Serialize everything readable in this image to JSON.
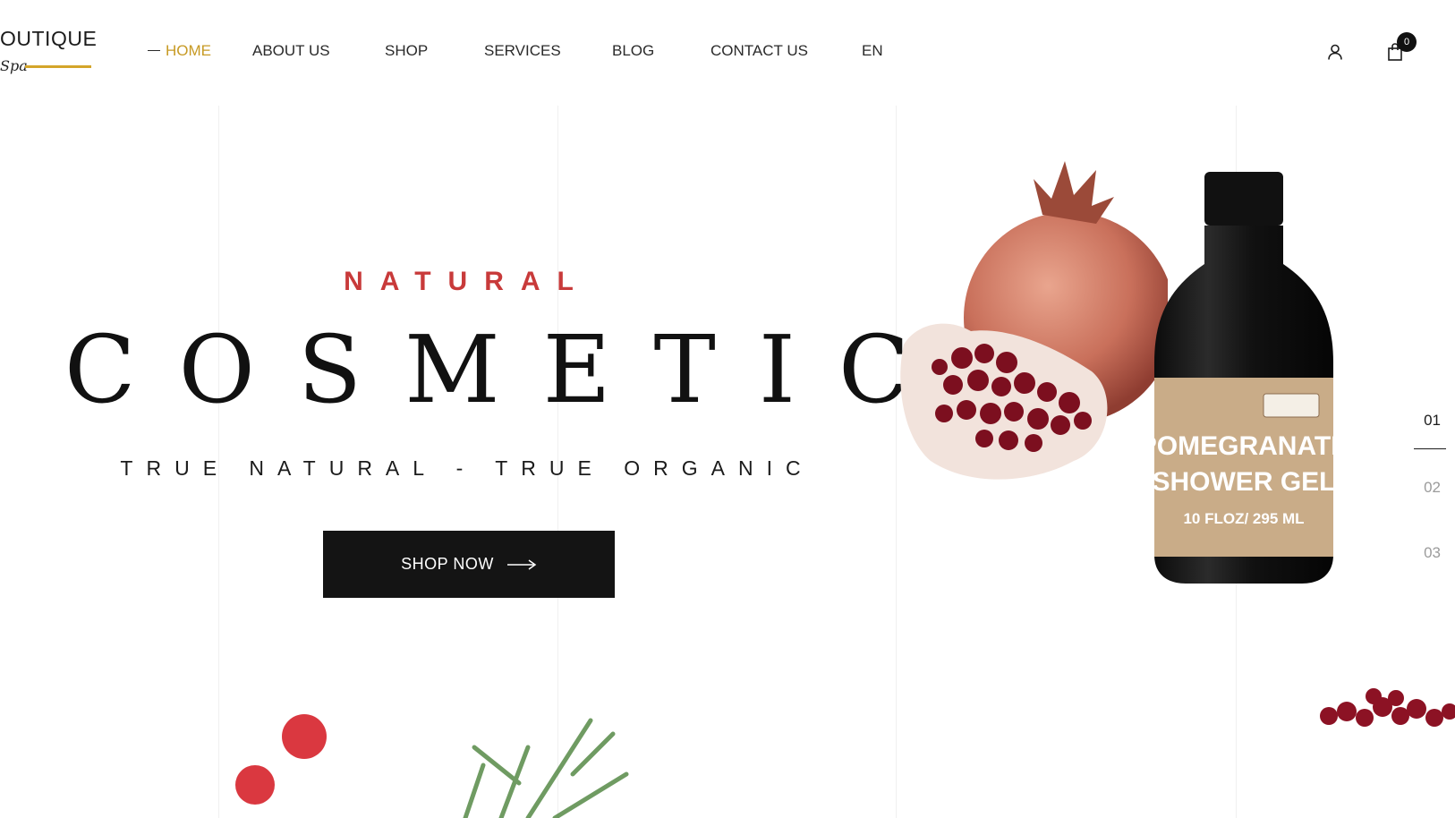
{
  "brand": {
    "name": "OUTIQUE",
    "script": "Spa"
  },
  "nav": {
    "items": [
      {
        "label": "HOME",
        "active": true
      },
      {
        "label": "ABOUT US"
      },
      {
        "label": "SHOP"
      },
      {
        "label": "SERVICES"
      },
      {
        "label": "BLOG"
      },
      {
        "label": "CONTACT US"
      },
      {
        "label": "EN"
      }
    ]
  },
  "header": {
    "cart_count": "0",
    "user_icon": "user-icon",
    "cart_icon": "shopping-bag-icon"
  },
  "hero": {
    "eyebrow": "NATURAL",
    "title": "COSMETIC",
    "tagline": "TRUE NATURAL - TRUE ORGANIC",
    "cta_label": "SHOP NOW",
    "cta_icon": "arrow-right-icon"
  },
  "product": {
    "label_line1": "POMEGRANATE",
    "label_line2": "SHOWER GEL",
    "label_line3": "10 FLOZ/ 295 ML"
  },
  "pager": {
    "items": [
      "01",
      "02",
      "03"
    ],
    "active_index": 0
  },
  "colors": {
    "accent_gold": "#c79a24",
    "accent_red": "#c83a3a",
    "dark": "#141414"
  }
}
